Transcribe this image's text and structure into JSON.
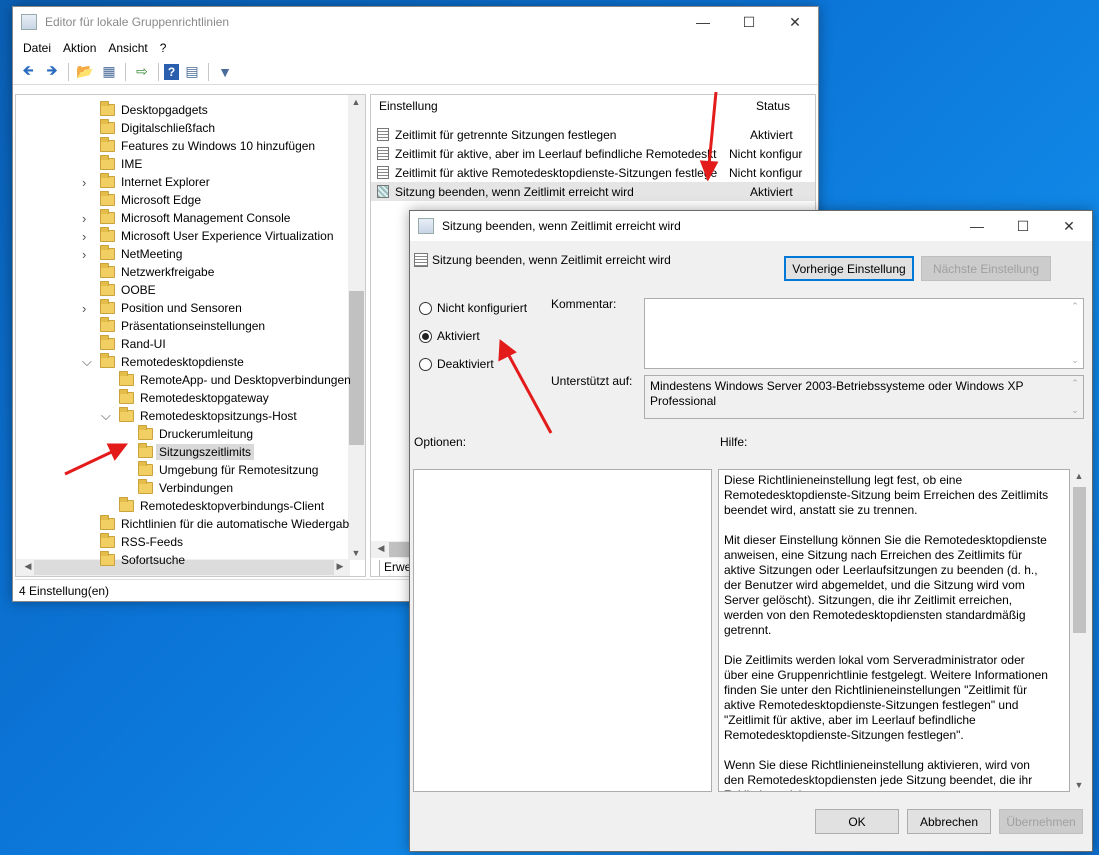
{
  "main": {
    "title": "Editor für lokale Gruppenrichtlinien",
    "menu": [
      "Datei",
      "Aktion",
      "Ansicht",
      "?"
    ],
    "tree": [
      {
        "label": "Desktopgadgets",
        "level": 0,
        "chev": ""
      },
      {
        "label": "Digitalschließfach",
        "level": 0,
        "chev": ""
      },
      {
        "label": "Features zu Windows 10 hinzufügen",
        "level": 0,
        "chev": ""
      },
      {
        "label": "IME",
        "level": 0,
        "chev": ""
      },
      {
        "label": "Internet Explorer",
        "level": 0,
        "chev": ">"
      },
      {
        "label": "Microsoft Edge",
        "level": 0,
        "chev": ""
      },
      {
        "label": "Microsoft Management Console",
        "level": 0,
        "chev": ">"
      },
      {
        "label": "Microsoft User Experience Virtualization",
        "level": 0,
        "chev": ">"
      },
      {
        "label": "NetMeeting",
        "level": 0,
        "chev": ">"
      },
      {
        "label": "Netzwerkfreigabe",
        "level": 0,
        "chev": ""
      },
      {
        "label": "OOBE",
        "level": 0,
        "chev": ""
      },
      {
        "label": "Position und Sensoren",
        "level": 0,
        "chev": ">"
      },
      {
        "label": "Präsentationseinstellungen",
        "level": 0,
        "chev": ""
      },
      {
        "label": "Rand-UI",
        "level": 0,
        "chev": ""
      },
      {
        "label": "Remotedesktopdienste",
        "level": 0,
        "chev": "v"
      },
      {
        "label": "RemoteApp- und Desktopverbindungen",
        "level": 1,
        "chev": ""
      },
      {
        "label": "Remotedesktopgateway",
        "level": 1,
        "chev": ""
      },
      {
        "label": "Remotedesktopsitzungs-Host",
        "level": 1,
        "chev": "v"
      },
      {
        "label": "Druckerumleitung",
        "level": 2,
        "chev": ""
      },
      {
        "label": "Sitzungszeitlimits",
        "level": 2,
        "chev": "",
        "selected": true
      },
      {
        "label": "Umgebung für Remotesitzung",
        "level": 2,
        "chev": ""
      },
      {
        "label": "Verbindungen",
        "level": 2,
        "chev": ""
      },
      {
        "label": "Remotedesktopverbindungs-Client",
        "level": 1,
        "chev": ""
      },
      {
        "label": "Richtlinien für die automatische Wiedergab",
        "level": 0,
        "chev": ""
      },
      {
        "label": "RSS-Feeds",
        "level": 0,
        "chev": ""
      },
      {
        "label": "Sofortsuche",
        "level": 0,
        "chev": ""
      }
    ],
    "list_header": {
      "setting": "Einstellung",
      "status": "Status"
    },
    "list": [
      {
        "setting": "Zeitlimit für getrennte Sitzungen festlegen",
        "status": "Aktiviert"
      },
      {
        "setting": "Zeitlimit für aktive, aber im Leerlauf befindliche Remotedeskt",
        "status": "Nicht konfigur"
      },
      {
        "setting": "Zeitlimit für aktive Remotedesktopdienste-Sitzungen festlege",
        "status": "Nicht konfigur"
      },
      {
        "setting": "Sitzung beenden, wenn Zeitlimit erreicht wird",
        "status": "Aktiviert",
        "selected": true
      }
    ],
    "tab_label": "Erwei",
    "status_text": "4 Einstellung(en)"
  },
  "dialog": {
    "title": "Sitzung beenden, wenn Zeitlimit erreicht wird",
    "subtitle": "Sitzung beenden, wenn Zeitlimit erreicht wird",
    "prev_button": "Vorherige Einstellung",
    "next_button": "Nächste Einstellung",
    "radios": {
      "not_configured": "Nicht konfiguriert",
      "enabled": "Aktiviert",
      "disabled": "Deaktiviert",
      "selected": "enabled"
    },
    "comment_label": "Kommentar:",
    "supported_label": "Unterstützt auf:",
    "supported_value": "Mindestens Windows Server 2003-Betriebssysteme oder Windows XP Professional",
    "options_label": "Optionen:",
    "help_label": "Hilfe:",
    "help_text": "Diese Richtlinieneinstellung legt fest, ob eine Remotedesktopdienste-Sitzung beim Erreichen des Zeitlimits beendet wird, anstatt sie zu trennen.\n\nMit dieser Einstellung können Sie die Remotedesktopdienste anweisen, eine Sitzung nach Erreichen des Zeitlimits für aktive Sitzungen oder Leerlaufsitzungen zu beenden (d. h., der Benutzer wird abgemeldet, und die Sitzung wird vom Server gelöscht). Sitzungen, die ihr Zeitlimit erreichen, werden von den Remotedesktopdiensten standardmäßig getrennt.\n\nDie Zeitlimits werden lokal vom Serveradministrator oder über eine Gruppenrichtlinie festgelegt. Weitere Informationen finden Sie unter den Richtlinieneinstellungen \"Zeitlimit für aktive Remotedesktopdienste-Sitzungen festlegen\" und \"Zeitlimit für aktive, aber im Leerlauf befindliche Remotedesktopdienste-Sitzungen festlegen\".\n\nWenn Sie diese Richtlinieneinstellung aktivieren, wird von den Remotedesktopdiensten jede Sitzung beendet, die ihr Zeitlimit erreicht.",
    "ok": "OK",
    "cancel": "Abbrechen",
    "apply": "Übernehmen"
  },
  "colors": {
    "annotation_arrow": "#e31b1b",
    "primary_border": "#0078d7"
  }
}
